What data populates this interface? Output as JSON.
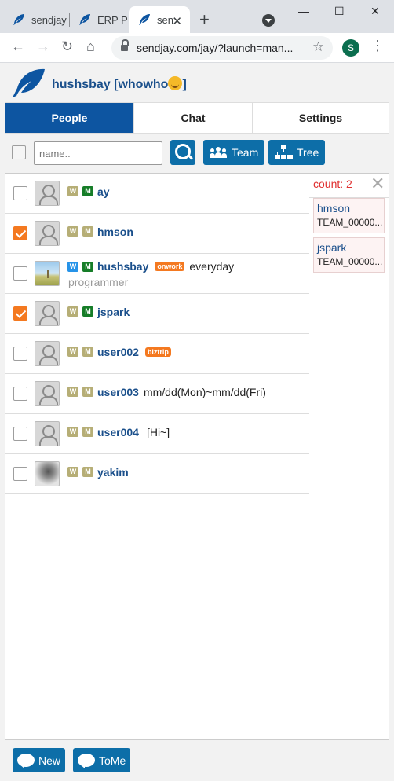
{
  "browser": {
    "tabs": [
      {
        "title": "sendjay"
      },
      {
        "title": "ERP Po"
      },
      {
        "title": "sen"
      }
    ],
    "url": "sendjay.com/jay/?launch=man...",
    "profile_initial": "S"
  },
  "app": {
    "user_title": "hushsbay [whowho",
    "tabs": [
      {
        "label": "People"
      },
      {
        "label": "Chat"
      },
      {
        "label": "Settings"
      }
    ],
    "search": {
      "placeholder": "name.."
    },
    "team_label": "Team",
    "tree_label": "Tree",
    "people": [
      {
        "name": "ay",
        "w": "W",
        "m": "M",
        "checked": false
      },
      {
        "name": "hmson",
        "w": "W",
        "m": "M",
        "checked": true
      },
      {
        "name": "hushsbay",
        "w": "W",
        "m": "M",
        "tag": "onwork",
        "message": "everyday",
        "sub": "programmer",
        "checked": false
      },
      {
        "name": "jspark",
        "w": "W",
        "m": "M",
        "checked": true
      },
      {
        "name": "user002",
        "w": "W",
        "m": "M",
        "tag": "biztrip",
        "checked": false
      },
      {
        "name": "user003",
        "w": "W",
        "m": "M",
        "message": "mm/dd(Mon)~mm/dd(Fri)",
        "checked": false
      },
      {
        "name": "user004",
        "w": "W",
        "m": "M",
        "message": "[Hi~]",
        "checked": false
      },
      {
        "name": "yakim",
        "w": "W",
        "m": "M",
        "checked": false
      }
    ],
    "selected": {
      "count_label": "count: 2",
      "items": [
        {
          "name": "hmson",
          "team": "TEAM_00000..."
        },
        {
          "name": "jspark",
          "team": "TEAM_00000..."
        }
      ]
    },
    "footer": {
      "new_label": "New",
      "tome_label": "ToMe"
    },
    "colors": {
      "primary": "#0d55a1",
      "button": "#0d6ea8",
      "accent": "#f47920"
    }
  }
}
